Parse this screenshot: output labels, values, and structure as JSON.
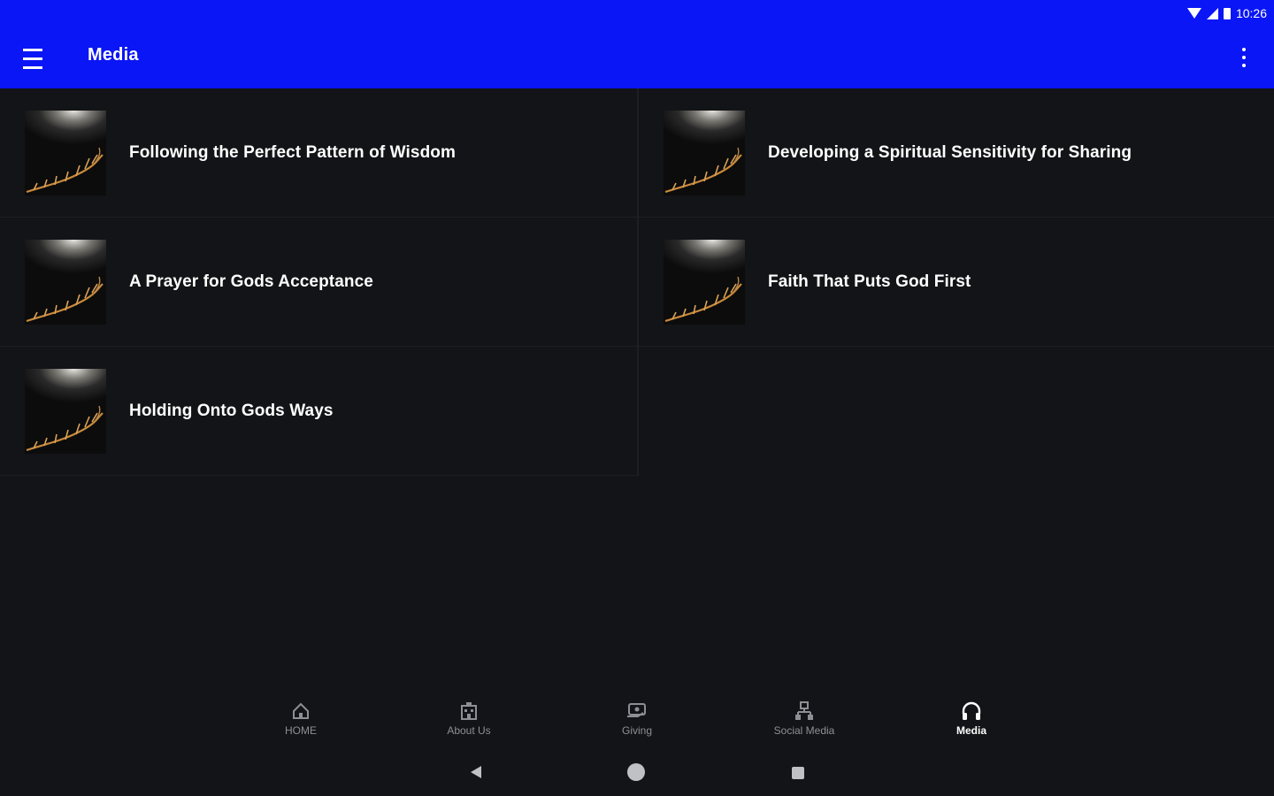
{
  "status_bar": {
    "time": "10:26",
    "icons": [
      "wifi-icon",
      "signal-icon",
      "battery-icon"
    ]
  },
  "app_bar": {
    "title": "Media",
    "menu_icon": "hamburger-menu-icon",
    "overflow_icon": "more-vertical-icon",
    "background": "#0a16f5"
  },
  "media_items": [
    {
      "title": "Following the Perfect Pattern of Wisdom"
    },
    {
      "title": "Developing a Spiritual Sensitivity for Sharing"
    },
    {
      "title": "A Prayer for Gods Acceptance"
    },
    {
      "title": "Faith That Puts God First"
    },
    {
      "title": "Holding Onto Gods Ways"
    }
  ],
  "bottom_nav": [
    {
      "label": "HOME",
      "icon": "home-icon",
      "active": false
    },
    {
      "label": "About Us",
      "icon": "building-icon",
      "active": false
    },
    {
      "label": "Giving",
      "icon": "giving-hand-icon",
      "active": false
    },
    {
      "label": "Social Media",
      "icon": "social-network-icon",
      "active": false
    },
    {
      "label": "Media",
      "icon": "headphones-icon",
      "active": true
    }
  ],
  "system_nav": {
    "icons": [
      "back-icon",
      "home-circle-icon",
      "recents-square-icon"
    ]
  },
  "colors": {
    "background": "#131417",
    "accent": "#0a16f5",
    "inactive_nav": "#8d8f94"
  }
}
